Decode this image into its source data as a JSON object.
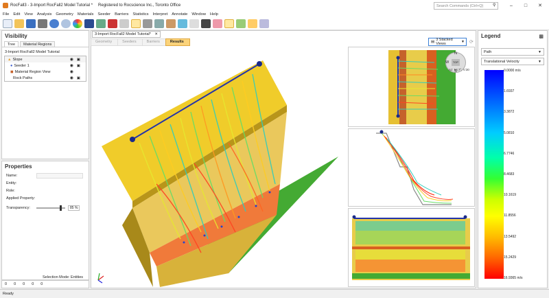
{
  "window": {
    "title": "RocFall3 - 3-Import RocFall2 Model Tutorial *",
    "registered": "Registered to Rocscience Inc., Toronto Office",
    "search_placeholder": "Search Commands (Ctrl+Q)"
  },
  "menu": [
    "File",
    "Edit",
    "View",
    "Analysis",
    "Geometry",
    "Materials",
    "Seeder",
    "Barriers",
    "Statistics",
    "Interpret",
    "Annotate",
    "Window",
    "Help"
  ],
  "visibility": {
    "title": "Visibility",
    "tabs": [
      "Tree",
      "Material Regions"
    ],
    "root": "3-Import RocFall2 Model Tutorial",
    "items": [
      "Slope",
      "Seeder 1",
      "Material Region View",
      "Rock Paths"
    ]
  },
  "properties": {
    "title": "Properties",
    "fields": [
      "Name:",
      "Entity:",
      "Role:",
      "Applied Property:"
    ],
    "transparency_label": "Transparency:",
    "transparency_value": "85 %",
    "transparency_level": 0.85,
    "selection_mode": "Selection Mode: Entities",
    "counts": [
      "0",
      "0",
      "0",
      "0",
      "0"
    ]
  },
  "document": {
    "tab": "3-Import RocFall2 Model Tutorial*",
    "crumbs": [
      "Geometry",
      "Seeders",
      "Barriers",
      "Results"
    ],
    "active_crumb": "Results",
    "layout": "3 Stacked Views",
    "compass_readout": "Az: 54.7°, V:30"
  },
  "legend": {
    "title": "Legend",
    "mode": "Path",
    "quantity": "Translational Velocity",
    "ticks": [
      "0.0000 m/s",
      "1.6937",
      "3.3872",
      "5.0810",
      "6.7746",
      "8.4683",
      "10.1619",
      "11.8556",
      "13.5492",
      "15.2429",
      "16.9365 m/s"
    ]
  },
  "status": "Ready"
}
